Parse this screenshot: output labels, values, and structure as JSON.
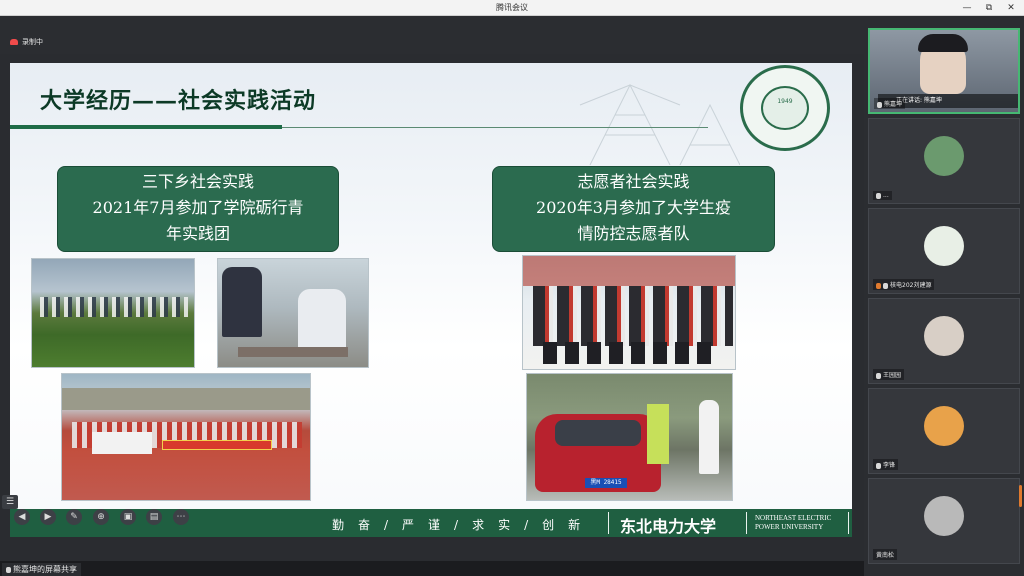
{
  "window": {
    "title": "腾讯会议",
    "controls": [
      "—",
      "⧉",
      "✕"
    ]
  },
  "recording": {
    "label": "录制中"
  },
  "slide": {
    "title": "大学经历——社会实践活动",
    "seal_year": "1949",
    "box_left": {
      "line1": "三下乡社会实践",
      "line2": "2021年7月参加了学院砺行青",
      "line3": "年实践团"
    },
    "box_right": {
      "line1": "志愿者社会实践",
      "line2": "2020年3月参加了大学生疫",
      "line3": "情防控志愿者队"
    },
    "plate": "黑M 28415",
    "footer": {
      "motto": "勤　奋　/　严　谨　/　求　实　/　创　新",
      "university_cn": "东北电力大学",
      "university_en_line1": "NORTHEAST ELECTRIC",
      "university_en_line2": "POWER UNIVERSITY"
    }
  },
  "share": {
    "label": "熊嘉坤的屏幕共享"
  },
  "participants": [
    {
      "name": "熊嘉坤",
      "speaking": "正在讲话: 熊嘉坤",
      "avatar_color": "#c9cfd6"
    },
    {
      "name": "...",
      "avatar_color": "#6b9a6e"
    },
    {
      "name": "核电202刘建源",
      "avatar_color": "#e8efe6"
    },
    {
      "name": "王园园",
      "avatar_color": "#d8cfc6"
    },
    {
      "name": "李锋",
      "avatar_color": "#e8a24a"
    },
    {
      "name": "黄南松",
      "avatar_color": "#b9b9b9"
    }
  ]
}
